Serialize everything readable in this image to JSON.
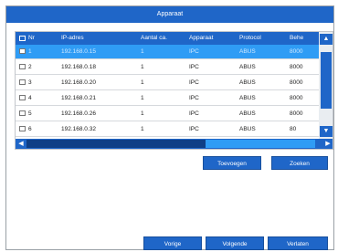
{
  "dialog": {
    "title": "Apparaat"
  },
  "table": {
    "columns": [
      "Nr",
      "IP-adres",
      "Aantal ca.",
      "Apparaat",
      "Protocol",
      "Behe"
    ],
    "rows": [
      {
        "nr": "1",
        "ip": "192.168.0.15",
        "count": "1",
        "device": "IPC",
        "protocol": "ABUS",
        "port": "8000",
        "selected": true
      },
      {
        "nr": "2",
        "ip": "192.168.0.18",
        "count": "1",
        "device": "IPC",
        "protocol": "ABUS",
        "port": "8000",
        "selected": false
      },
      {
        "nr": "3",
        "ip": "192.168.0.20",
        "count": "1",
        "device": "IPC",
        "protocol": "ABUS",
        "port": "8000",
        "selected": false
      },
      {
        "nr": "4",
        "ip": "192.168.0.21",
        "count": "1",
        "device": "IPC",
        "protocol": "ABUS",
        "port": "8000",
        "selected": false
      },
      {
        "nr": "5",
        "ip": "192.168.0.26",
        "count": "1",
        "device": "IPC",
        "protocol": "ABUS",
        "port": "8000",
        "selected": false
      },
      {
        "nr": "6",
        "ip": "192.168.0.32",
        "count": "1",
        "device": "IPC",
        "protocol": "ABUS",
        "port": "80",
        "selected": false
      }
    ]
  },
  "buttons": {
    "add": "Toevoegen",
    "search": "Zoeken",
    "prev": "Vorige",
    "next": "Volgende",
    "cancel": "Verlaten"
  },
  "icons": {
    "up": "▲",
    "down": "▼",
    "left": "◀",
    "right": "▶"
  },
  "colors": {
    "accent": "#1f66c8",
    "selected_row": "#2f9cf5"
  }
}
